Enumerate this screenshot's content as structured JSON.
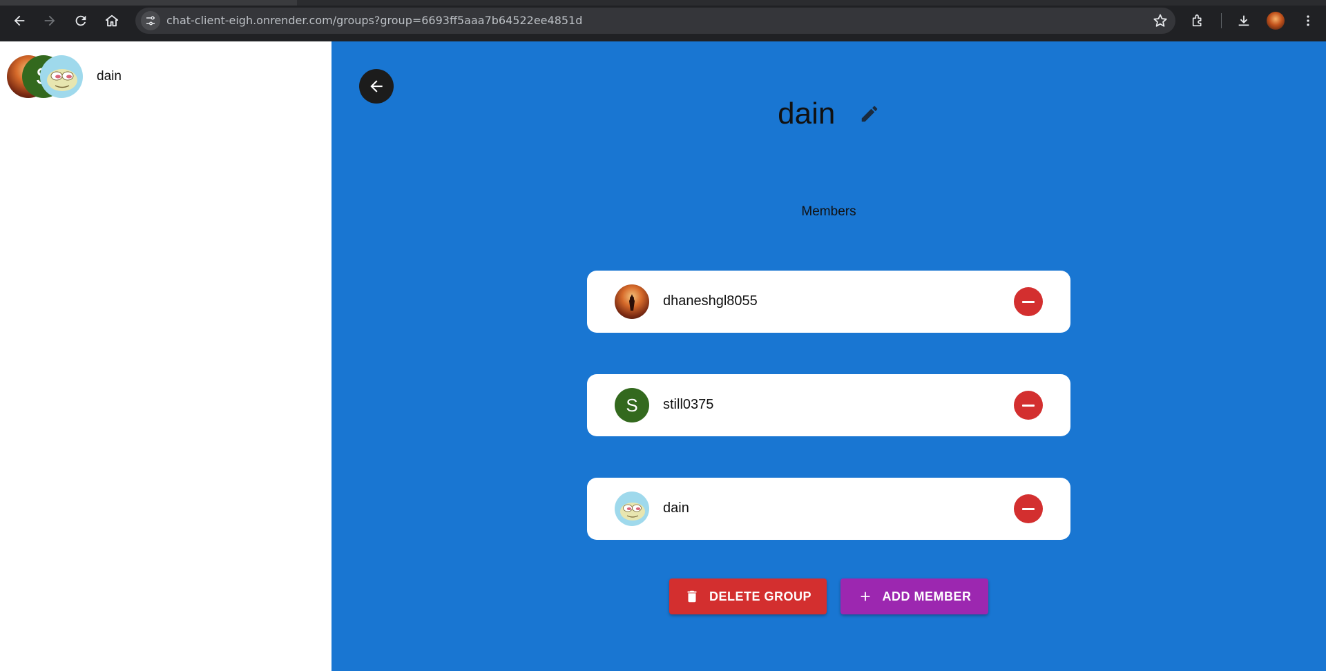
{
  "browser": {
    "url": "chat-client-eigh.onrender.com/groups?group=6693ff5aaa7b64522ee4851d",
    "icons": [
      "back-icon",
      "forward-icon",
      "reload-icon",
      "home-icon",
      "site-info-icon",
      "bookmark-star-icon",
      "extensions-icon",
      "download-icon",
      "menu-icon"
    ]
  },
  "sidebar": {
    "group": {
      "name": "dain",
      "avatar_letter": "S"
    }
  },
  "main": {
    "title": "dain",
    "members_label": "Members",
    "members": [
      {
        "name": "dhaneshgl8055",
        "avatar": "fire-avatar"
      },
      {
        "name": "still0375",
        "avatar": "letter",
        "avatar_letter": "S"
      },
      {
        "name": "dain",
        "avatar": "pepe-avatar"
      }
    ],
    "delete_label": "DELETE GROUP",
    "add_label": "ADD MEMBER"
  },
  "colors": {
    "main_bg": "#1976d2",
    "delete": "#d32f2f",
    "add": "#9c27b0",
    "letter_avatar": "#33691e"
  }
}
